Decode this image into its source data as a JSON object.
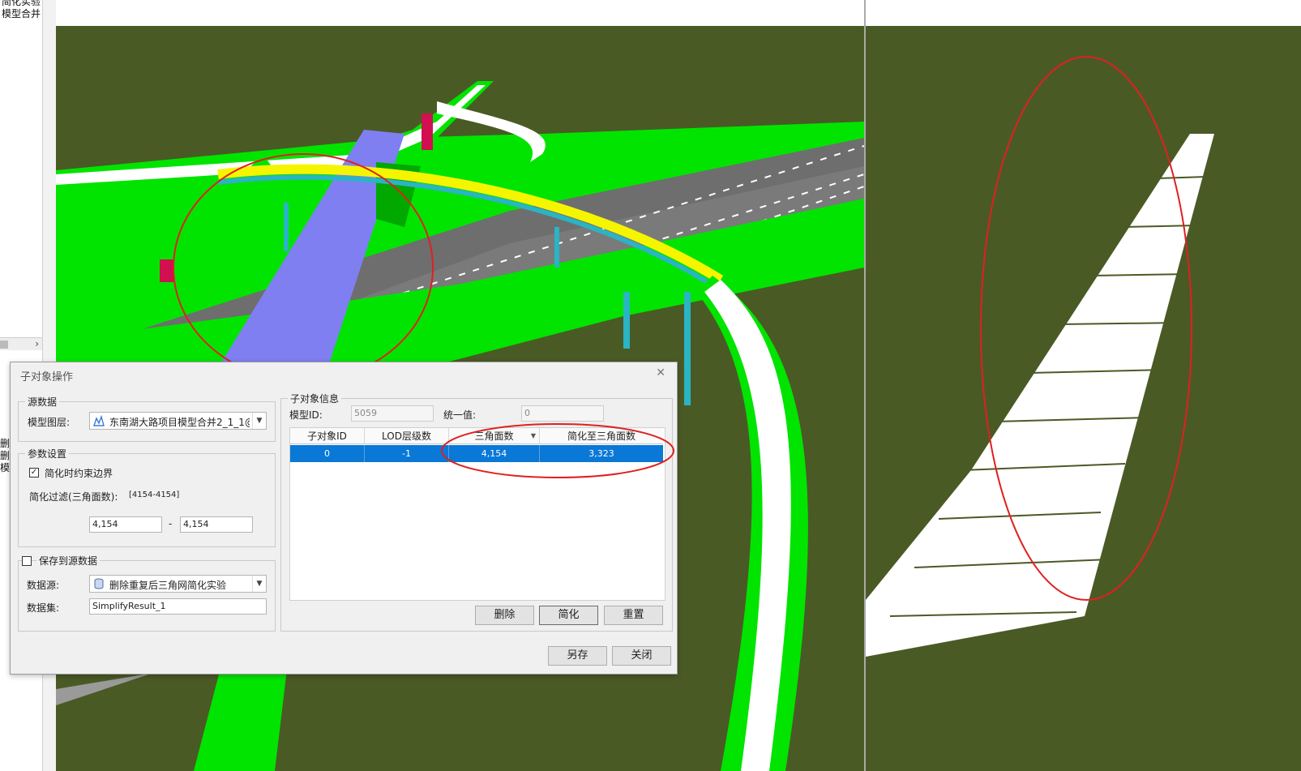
{
  "left_panel": {
    "lines": [
      "简化实验",
      "模型合并"
    ],
    "lower_lines": [
      "删",
      "删",
      "模"
    ],
    "scroll_arrow": "›"
  },
  "dialog": {
    "title": "子对象操作",
    "close": "✕",
    "source_group": {
      "title": "源数据",
      "layer_label": "模型图层:",
      "layer_value": "东南湖大路项目模型合并2_1_1@",
      "layer_icon": "model-layer-icon"
    },
    "params_group": {
      "title": "参数设置",
      "constrain_label": "简化时约束边界",
      "constrain_checked": "✓",
      "filter_label": "简化过滤(三角面数):",
      "filter_range": "[4154-4154]",
      "filter_min": "4,154",
      "filter_sep": "-",
      "filter_max": "4,154"
    },
    "save_group": {
      "title": "保存到源数据",
      "datasource_label": "数据源:",
      "datasource_value": "删除重复后三角网简化实验",
      "datasource_icon": "database-icon",
      "dataset_label": "数据集:",
      "dataset_value": "SimplifyResult_1"
    },
    "subobject_group": {
      "title": "子对象信息",
      "model_id_label": "模型ID:",
      "model_id_value": "5059",
      "unified_label": "统一值:",
      "unified_value": "0",
      "columns": [
        "子对象ID",
        "LOD层级数",
        "三角面数",
        "简化至三角面数"
      ],
      "rows": [
        [
          "0",
          "-1",
          "4,154",
          "3,323"
        ]
      ]
    },
    "buttons": {
      "delete": "删除",
      "simplify": "简化",
      "reset": "重置",
      "save_as": "另存",
      "close": "关闭"
    }
  },
  "colors": {
    "terrain": "#4a5a25",
    "road_green": "#00e400",
    "highlight_circle": "#e02020",
    "selection": "#0a78d7",
    "bridge_yellow": "#f5f500",
    "lane_blue": "#7f7ff2"
  }
}
